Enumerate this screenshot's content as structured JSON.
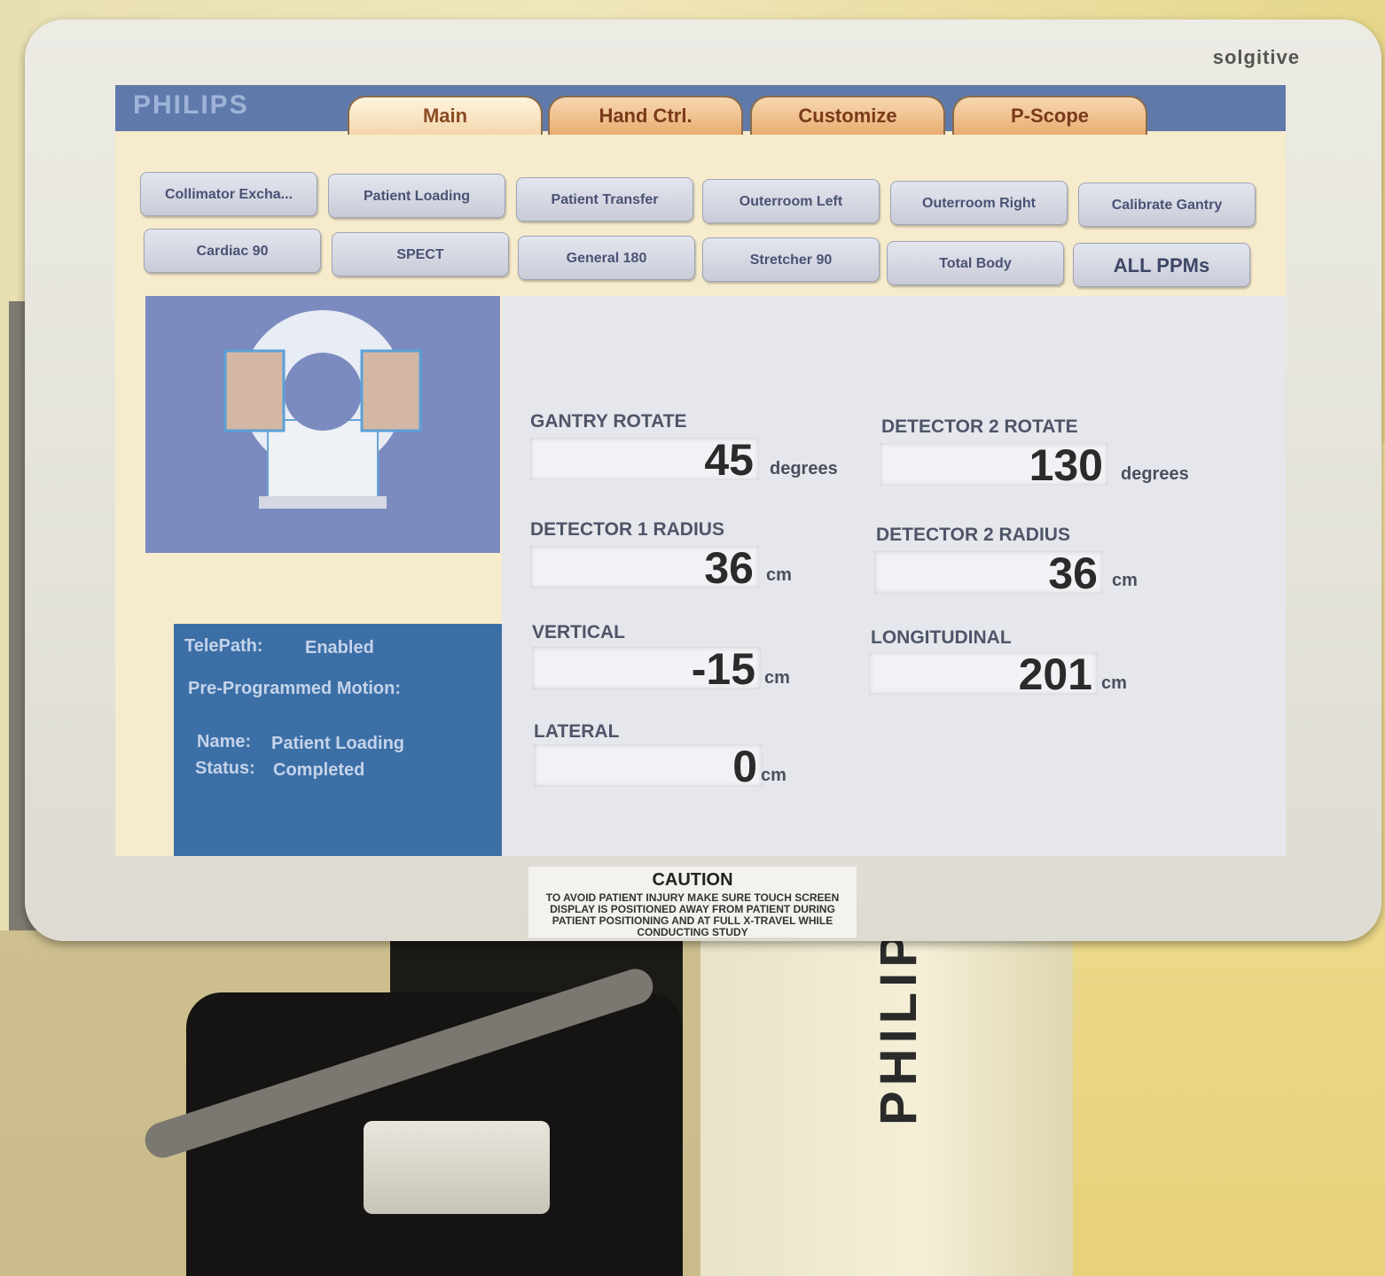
{
  "bezel": {
    "brand": "solgitive",
    "caution_title": "CAUTION",
    "caution_text": "TO AVOID PATIENT INJURY MAKE SURE TOUCH SCREEN DISPLAY IS POSITIONED AWAY FROM PATIENT DURING PATIENT POSITIONING AND AT FULL X-TRAVEL WHILE CONDUCTING STUDY"
  },
  "machine_brand": "PHILIPS",
  "screen": {
    "logo": "PHILIPS",
    "tabs": [
      {
        "label": "Main",
        "active": true
      },
      {
        "label": "Hand Ctrl.",
        "active": false
      },
      {
        "label": "Customize",
        "active": false
      },
      {
        "label": "P-Scope",
        "active": false
      }
    ],
    "ppm_buttons_row1": [
      "Collimator Excha...",
      "Patient Loading",
      "Patient Transfer",
      "Outerroom Left",
      "Outerroom Right",
      "Calibrate Gantry"
    ],
    "ppm_buttons_row2": [
      "Cardiac 90",
      "SPECT",
      "General 180",
      "Stretcher 90",
      "Total Body",
      "ALL PPMs"
    ],
    "status": {
      "telepath_label": "TelePath:",
      "telepath_value": "Enabled",
      "ppm_label": "Pre-Programmed Motion:",
      "name_label": "Name:",
      "name_value": "Patient Loading",
      "status_label": "Status:",
      "status_value": "Completed"
    },
    "readouts": {
      "gantry_rotate": {
        "label": "GANTRY ROTATE",
        "value": "45",
        "unit": "degrees"
      },
      "detector2_rotate": {
        "label": "DETECTOR 2 ROTATE",
        "value": "130",
        "unit": "degrees"
      },
      "detector1_radius": {
        "label": "DETECTOR 1 RADIUS",
        "value": "36",
        "unit": "cm"
      },
      "detector2_radius": {
        "label": "DETECTOR 2 RADIUS",
        "value": "36",
        "unit": "cm"
      },
      "vertical": {
        "label": "VERTICAL",
        "value": "-15",
        "unit": "cm"
      },
      "longitudinal": {
        "label": "LONGITUDINAL",
        "value": "201",
        "unit": "cm"
      },
      "lateral": {
        "label": "LATERAL",
        "value": "0",
        "unit": "cm"
      }
    }
  },
  "colors": {
    "tab_fill": "#e9ad72",
    "tab_text": "#7a3a1a",
    "status_panel": "#3c6fa6",
    "diagram_panel": "#7b8bc0",
    "readout_bg": "#e5e7ec"
  }
}
